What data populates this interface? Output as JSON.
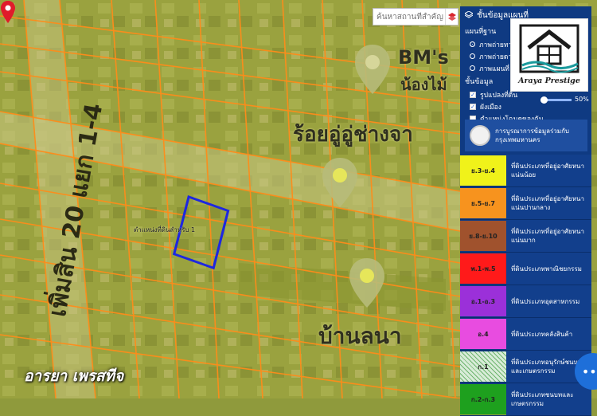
{
  "search": {
    "placeholder": "ค้นหาสถานที่สำคัญ"
  },
  "map": {
    "labels": {
      "road_vertical": "เพิ่มสิน 20 แยก 1-4",
      "place_bms_1": "BM's",
      "place_bms_2": "น้องไม้",
      "place_shop": "ร้อยอู่อู่ช่างจา",
      "place_home": "บ้านลนา",
      "pin_label": "ตำแหน่งที่ดินสำหรับ 1"
    },
    "watermark": "อารยา เพรสทีจ"
  },
  "panel": {
    "title": "ชั้นข้อมูลแผนที่",
    "basemap_title": "แผนที่ฐาน",
    "basemaps": [
      {
        "label": "ภาพถ่ายทางอากาศ",
        "selected": true
      },
      {
        "label": "ภาพถ่ายดาวเทียม",
        "selected": false
      },
      {
        "label": "ภาพแผนที่",
        "selected": false
      }
    ],
    "layers_title": "ชั้นข้อมูล",
    "layers": [
      {
        "label": "รูปแปลงที่ดิน",
        "checked": true
      },
      {
        "label": "ผังเมือง",
        "checked": true
      },
      {
        "label": "ตำแหน่งโฉนดของฉัน",
        "checked": false
      }
    ],
    "opacity_value": "50%",
    "opacity_level": 0.5,
    "org_name": "การบูรณาการข้อมูลร่วมกับ กรุงเทพมหานคร",
    "logo_text": "Araya Prestige"
  },
  "legend": [
    {
      "code": "ย.3-ย.4",
      "label": "ที่ดินประเภทที่อยู่อาศัยหนาแน่นน้อย",
      "color": "#f0f21a"
    },
    {
      "code": "ย.5-ย.7",
      "label": "ที่ดินประเภทที่อยู่อาศัยหนาแน่นปานกลาง",
      "color": "#f7931e"
    },
    {
      "code": "ย.8-ย.10",
      "label": "ที่ดินประเภทที่อยู่อาศัยหนาแน่นมาก",
      "color": "#a0522d"
    },
    {
      "code": "พ.1-พ.5",
      "label": "ที่ดินประเภทพาณิชยกรรม",
      "color": "#ff1a1a"
    },
    {
      "code": "อ.1-อ.3",
      "label": "ที่ดินประเภทอุตสาหกรรม",
      "color": "#9b30d9"
    },
    {
      "code": "อ.4",
      "label": "ที่ดินประเภทคลังสินค้า",
      "color": "#e84ce0"
    },
    {
      "code": "ก.1",
      "label": "ที่ดินประเภทอนุรักษ์ชนบทและเกษตรกรรม",
      "color": "#d8ecd8"
    },
    {
      "code": "ก.2-ก.3",
      "label": "ที่ดินประเภทชนบทและเกษตรกรรม",
      "color": "#1ea01e"
    }
  ],
  "colors": {
    "panel": "#0f3a82",
    "plot_outline": "#1d27e0",
    "pin": "#e01b2a",
    "parcel_line": "#ff8c1a"
  }
}
